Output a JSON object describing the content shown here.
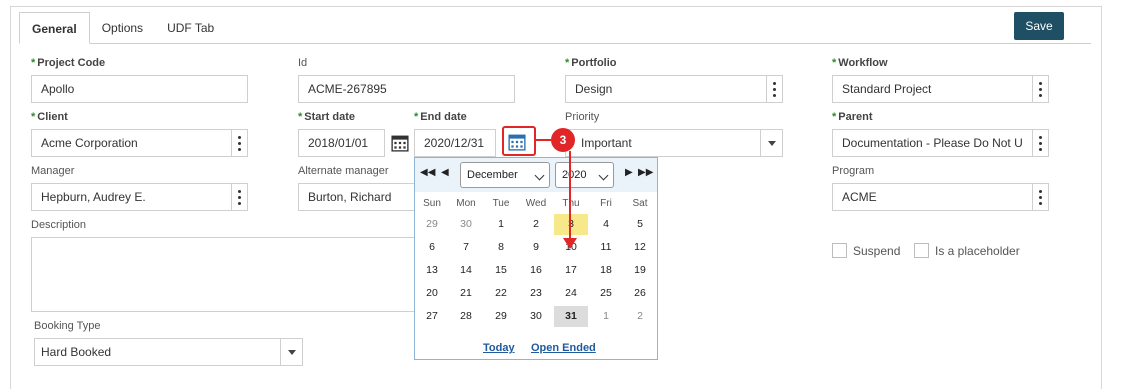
{
  "tabs": [
    {
      "label": "General",
      "active": true
    },
    {
      "label": "Options",
      "active": false
    },
    {
      "label": "UDF Tab",
      "active": false
    }
  ],
  "save_label": "Save",
  "required_marker": "*",
  "fields": {
    "project_code": {
      "label": "Project Code",
      "value": "Apollo",
      "required": true
    },
    "id": {
      "label": "Id",
      "value": "ACME-267895"
    },
    "portfolio": {
      "label": "Portfolio",
      "value": "Design",
      "required": true
    },
    "workflow": {
      "label": "Workflow",
      "value": "Standard Project",
      "required": true
    },
    "client": {
      "label": "Client",
      "value": "Acme Corporation",
      "required": true
    },
    "start_date": {
      "label": "Start date",
      "value": "2018/01/01",
      "required": true
    },
    "end_date": {
      "label": "End date",
      "value": "2020/12/31",
      "required": true
    },
    "priority": {
      "label": "Priority",
      "value": "Important"
    },
    "parent": {
      "label": "Parent",
      "value": "Documentation - Please Do Not U",
      "required": true
    },
    "manager": {
      "label": "Manager",
      "value": "Hepburn, Audrey E."
    },
    "alternate_manager": {
      "label": "Alternate manager",
      "value": "Burton, Richard"
    },
    "program": {
      "label": "Program",
      "value": "ACME"
    },
    "description": {
      "label": "Description",
      "value": ""
    },
    "booking_type": {
      "label": "Booking Type",
      "value": "Hard Booked"
    }
  },
  "checkboxes": {
    "suspend": {
      "label": "Suspend",
      "checked": false
    },
    "placeholder": {
      "label": "Is a placeholder",
      "checked": false
    }
  },
  "calendar": {
    "month": "December",
    "year": "2020",
    "weekdays": [
      "Sun",
      "Mon",
      "Tue",
      "Wed",
      "Thu",
      "Fri",
      "Sat"
    ],
    "weeks": [
      [
        "29",
        "30",
        "1",
        "2",
        "3",
        "4",
        "5"
      ],
      [
        "6",
        "7",
        "8",
        "9",
        "10",
        "11",
        "12"
      ],
      [
        "13",
        "14",
        "15",
        "16",
        "17",
        "18",
        "19"
      ],
      [
        "20",
        "21",
        "22",
        "23",
        "24",
        "25",
        "26"
      ],
      [
        "27",
        "28",
        "29",
        "30",
        "31",
        "1",
        "2"
      ]
    ],
    "today_label": "Today",
    "open_ended_label": "Open Ended"
  },
  "callout": {
    "number": "3",
    "color": "#e02626"
  },
  "colors": {
    "save_button": "#1e4f64",
    "required_marker": "#2e8a2e",
    "today_highlight": "#f7e98a",
    "link": "#1f5a9c"
  }
}
